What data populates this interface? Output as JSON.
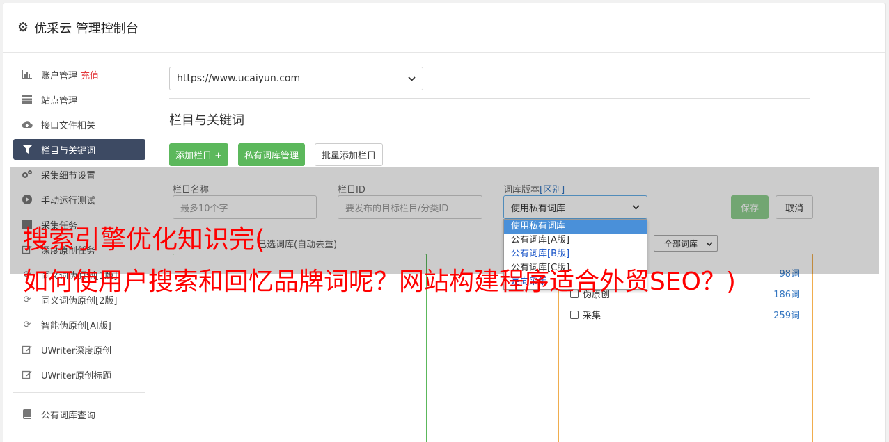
{
  "app": {
    "title": "优采云 管理控制台"
  },
  "sidebar": {
    "items": [
      {
        "label": "账户管理",
        "badge": "充值",
        "icon": "bar-chart-icon"
      },
      {
        "label": "站点管理",
        "icon": "server-icon"
      },
      {
        "label": "接口文件相关",
        "icon": "cloud-upload-icon"
      },
      {
        "label": "栏目与关键词",
        "icon": "filter-icon",
        "active": true
      },
      {
        "label": "采集细节设置",
        "icon": "gears-icon"
      },
      {
        "label": "手动运行测试",
        "icon": "play-circle-icon"
      },
      {
        "label": "采集任务",
        "icon": "tasks-icon"
      },
      {
        "label": "深度原创任务",
        "icon": "edit-icon"
      },
      {
        "label": "同义词伪原创[1版]",
        "icon": "refresh-icon"
      },
      {
        "label": "同义词伪原创[2版]",
        "icon": "refresh-icon"
      },
      {
        "label": "智能伪原创[AI版]",
        "icon": "refresh-icon"
      },
      {
        "label": "UWriter深度原创",
        "icon": "edit-icon"
      },
      {
        "label": "UWriter原创标题",
        "icon": "edit-icon"
      }
    ],
    "bottom_items": [
      {
        "label": "公有词库查询",
        "icon": "book-icon"
      }
    ]
  },
  "main": {
    "site_select": {
      "value": "https://www.ucaiyun.com"
    },
    "section_title": "栏目与关键词",
    "buttons": {
      "add_column": "添加栏目 +",
      "private_lib": "私有词库管理",
      "batch_add": "批量添加栏目"
    },
    "form": {
      "name_label": "栏目名称",
      "name_placeholder": "最多10个字",
      "id_label": "栏目ID",
      "id_placeholder": "要发布的目标栏目/分类ID",
      "lib_label": "词库版本",
      "lib_label_link": "[区别]",
      "lib_value": "使用私有词库",
      "save": "保存",
      "cancel": "取消"
    },
    "dropdown_options": [
      "使用私有词库",
      "公有词库[A版]",
      "公有词库[B版]",
      "公有词库[C版]",
      "定向采集"
    ],
    "keywords_label": "已选词库(自动去重)",
    "lib_filter": "全部词库",
    "libraries": [
      {
        "name": "",
        "count": "98词"
      },
      {
        "name": "伪原创",
        "count": "186词"
      },
      {
        "name": "采集",
        "count": "259词"
      }
    ]
  },
  "overlay_title": {
    "line1": "搜索引擎优化知识完(",
    "line2": "如何使用户搜索和回忆品牌词呢？网站构建程序适合外贸SEO？)"
  }
}
